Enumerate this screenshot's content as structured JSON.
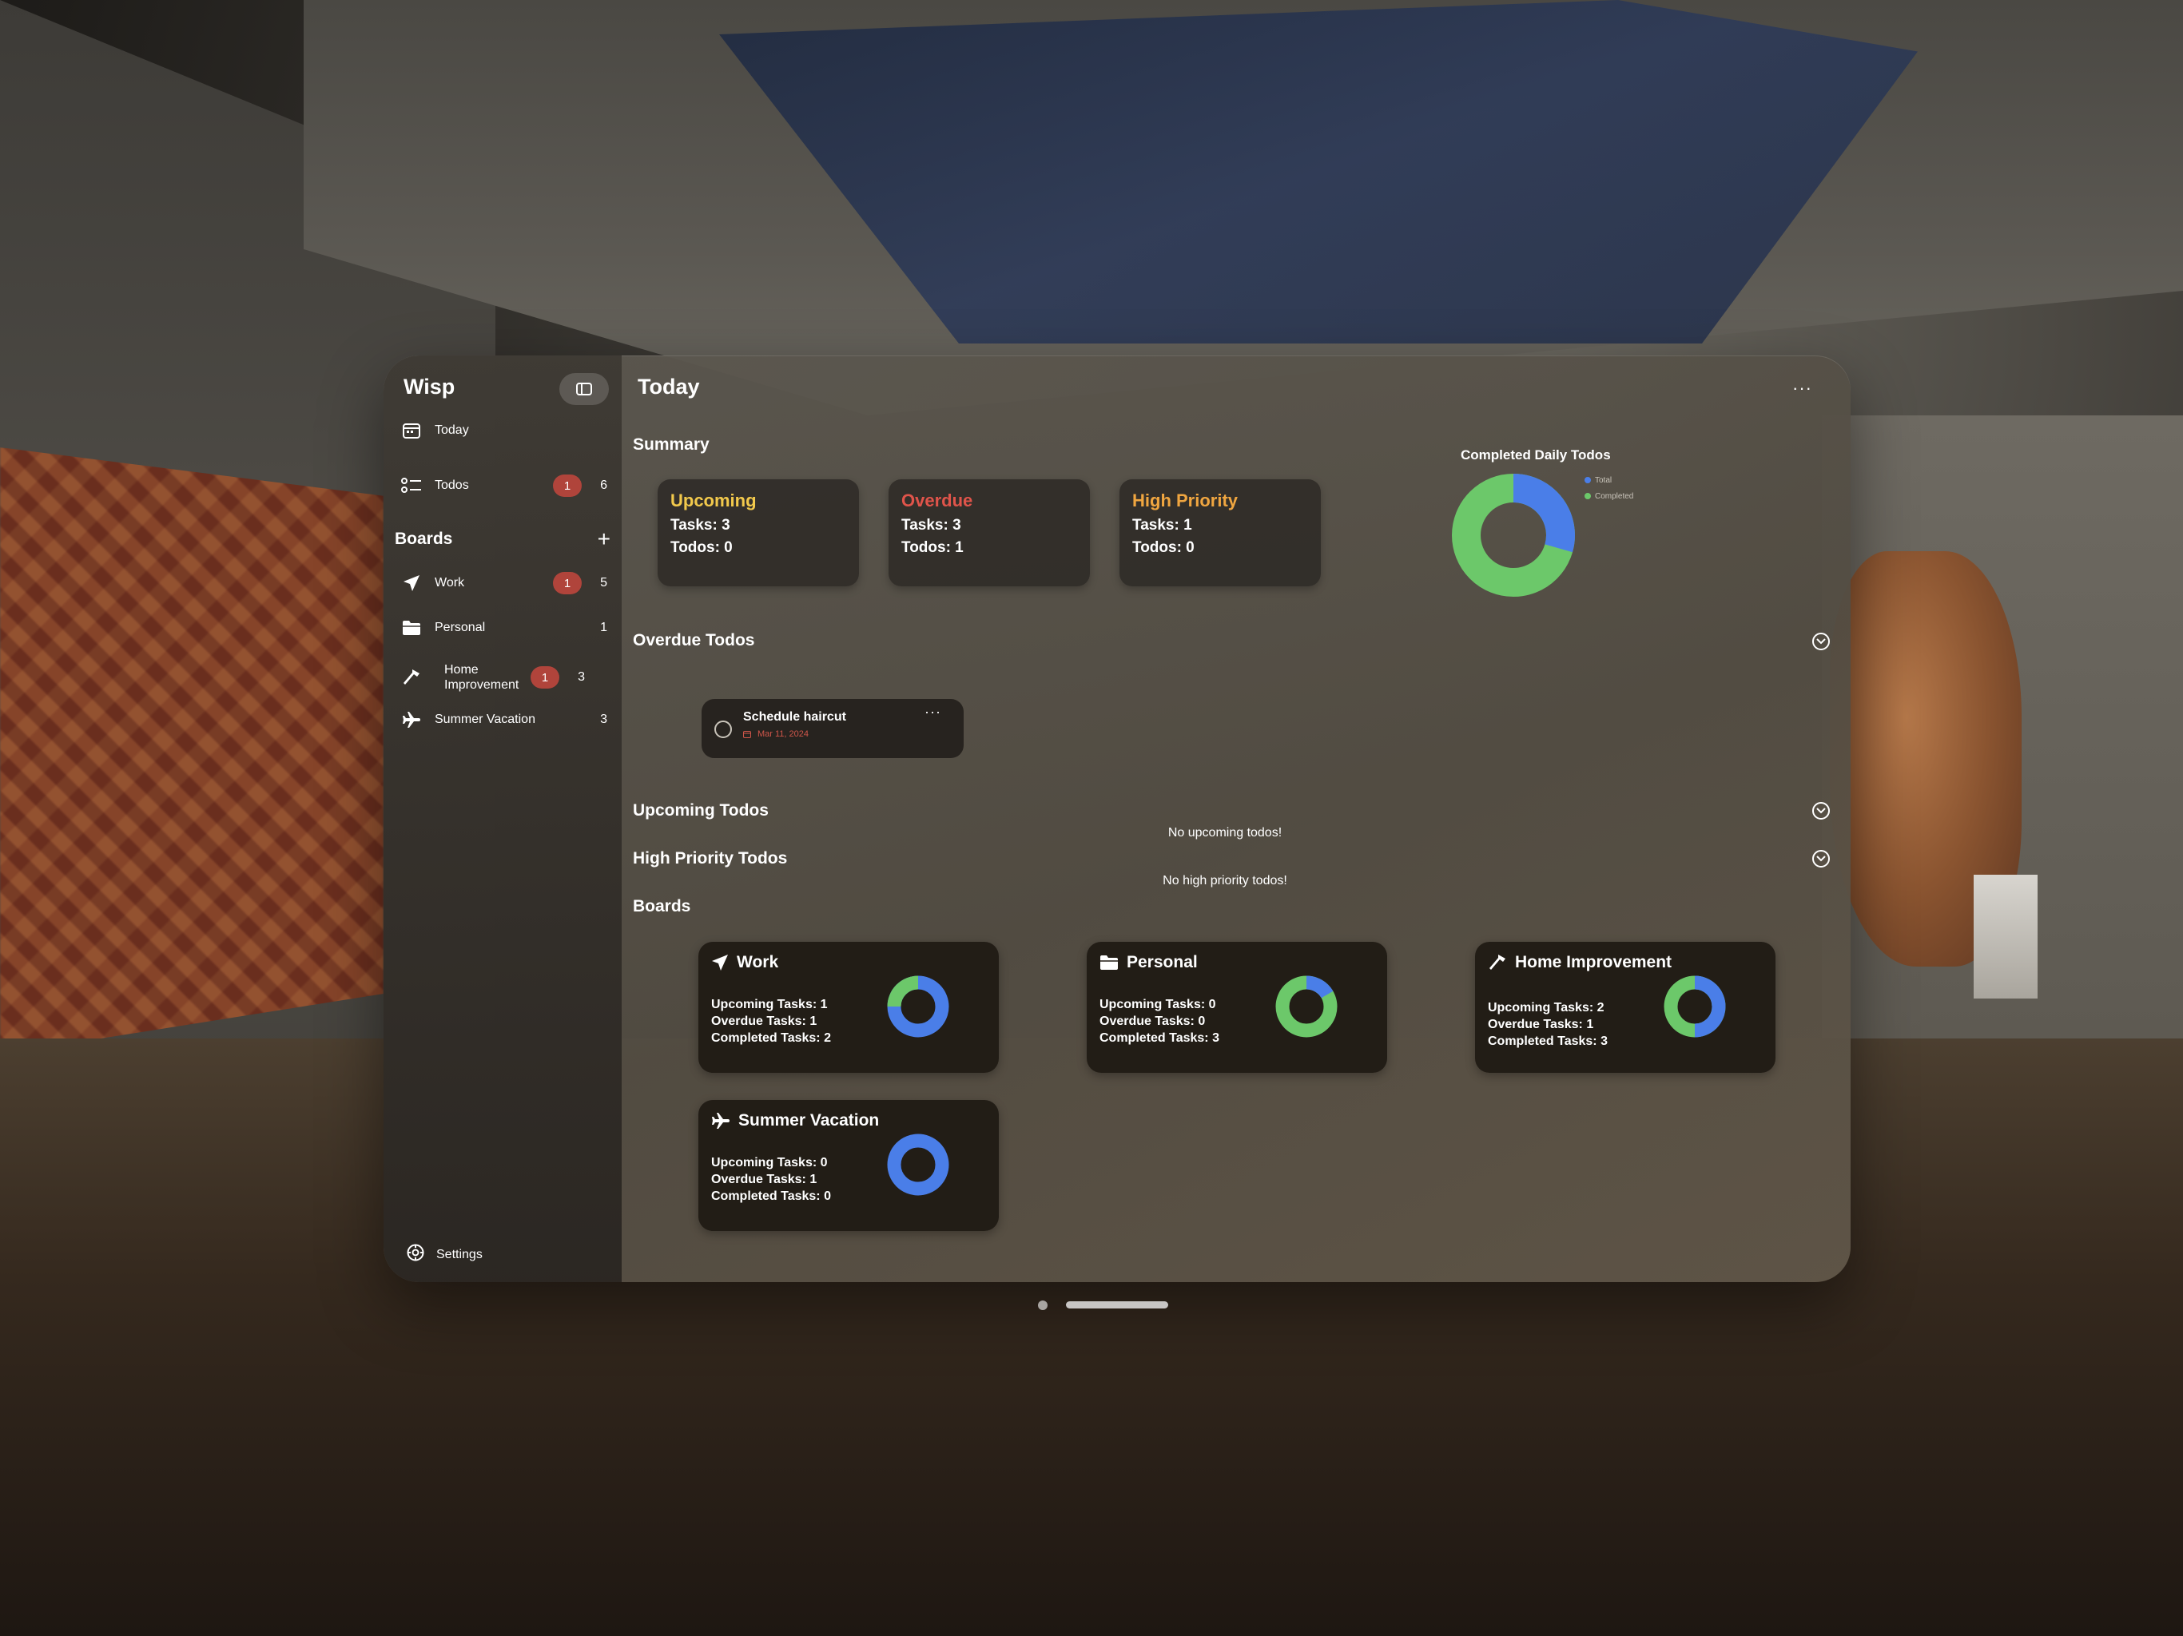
{
  "app": {
    "name": "Wisp"
  },
  "sidebar": {
    "nav": [
      {
        "label": "Today",
        "icon": "calendar-icon"
      },
      {
        "label": "Todos",
        "icon": "checklist-icon",
        "badge": "1",
        "count": "6"
      }
    ],
    "boards_title": "Boards",
    "boards": [
      {
        "label": "Work",
        "icon": "paperplane-icon",
        "badge": "1",
        "count": "5"
      },
      {
        "label": "Personal",
        "icon": "folder-icon",
        "count": "1"
      },
      {
        "label": "Home Improvement",
        "icon": "hammer-icon",
        "badge": "1",
        "count": "3"
      },
      {
        "label": "Summer Vacation",
        "icon": "airplane-icon",
        "count": "3"
      }
    ],
    "settings": "Settings"
  },
  "main": {
    "title": "Today",
    "summary_title": "Summary",
    "summary": [
      {
        "title": "Upcoming",
        "color": "#f2c94c",
        "tasks": "Tasks: 3",
        "todos": "Todos: 0"
      },
      {
        "title": "Overdue",
        "color": "#e0544a",
        "tasks": "Tasks: 3",
        "todos": "Todos: 1"
      },
      {
        "title": "High Priority",
        "color": "#f0a640",
        "tasks": "Tasks: 1",
        "todos": "Todos: 0"
      }
    ],
    "completed_chart": {
      "title": "Completed Daily Todos",
      "legend": [
        "Total",
        "Completed"
      ]
    },
    "overdue_title": "Overdue Todos",
    "overdue_todo": {
      "name": "Schedule haircut",
      "date": "Mar 11, 2024"
    },
    "upcoming_title": "Upcoming Todos",
    "upcoming_empty": "No upcoming todos!",
    "high_priority_title": "High Priority Todos",
    "high_priority_empty": "No high priority todos!",
    "boards_title": "Boards",
    "boards": [
      {
        "name": "Work",
        "icon": "paperplane-icon",
        "upcoming": "Upcoming Tasks: 1",
        "overdue": "Overdue Tasks: 1",
        "completed": "Completed Tasks: 2"
      },
      {
        "name": "Personal",
        "icon": "folder-icon",
        "upcoming": "Upcoming Tasks: 0",
        "overdue": "Overdue Tasks: 0",
        "completed": "Completed Tasks: 3"
      },
      {
        "name": "Home Improvement",
        "icon": "hammer-icon",
        "upcoming": "Upcoming Tasks: 2",
        "overdue": "Overdue Tasks: 1",
        "completed": "Completed Tasks: 3"
      },
      {
        "name": "Summer Vacation",
        "icon": "airplane-icon",
        "upcoming": "Upcoming Tasks: 0",
        "overdue": "Overdue Tasks: 1",
        "completed": "Completed Tasks: 0"
      }
    ]
  },
  "colors": {
    "total": "#4a7ee8",
    "completed": "#6cc86a"
  }
}
